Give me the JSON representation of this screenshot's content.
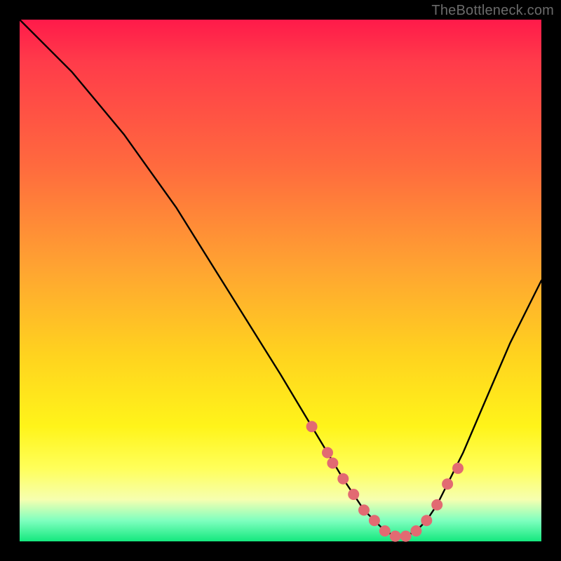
{
  "attribution": "TheBottleneck.com",
  "chart_data": {
    "type": "line",
    "title": "",
    "xlabel": "",
    "ylabel": "",
    "xlim": [
      0,
      100
    ],
    "ylim": [
      0,
      100
    ],
    "background_gradient": {
      "top": "#ff1a4a",
      "mid_upper": "#ffa531",
      "mid_lower": "#fff41a",
      "bottom": "#14e87e"
    },
    "series": [
      {
        "name": "bottleneck-curve",
        "x": [
          0,
          5,
          10,
          15,
          20,
          25,
          30,
          35,
          40,
          45,
          50,
          53,
          56,
          59,
          62,
          64,
          66,
          68,
          70,
          72,
          74,
          76,
          78,
          80,
          82,
          85,
          88,
          91,
          94,
          97,
          100
        ],
        "values": [
          100,
          95,
          90,
          84,
          78,
          71,
          64,
          56,
          48,
          40,
          32,
          27,
          22,
          17,
          12,
          9,
          6,
          4,
          2,
          1,
          1,
          2,
          4,
          7,
          11,
          17,
          24,
          31,
          38,
          44,
          50
        ]
      }
    ],
    "highlight_points": {
      "name": "flat-zone-dots",
      "color": "#e26a72",
      "x": [
        56,
        59,
        60,
        62,
        64,
        66,
        68,
        70,
        72,
        74,
        76,
        78,
        80,
        82,
        84
      ],
      "values": [
        22,
        17,
        15,
        12,
        9,
        6,
        4,
        2,
        1,
        1,
        2,
        4,
        7,
        11,
        14
      ]
    }
  }
}
